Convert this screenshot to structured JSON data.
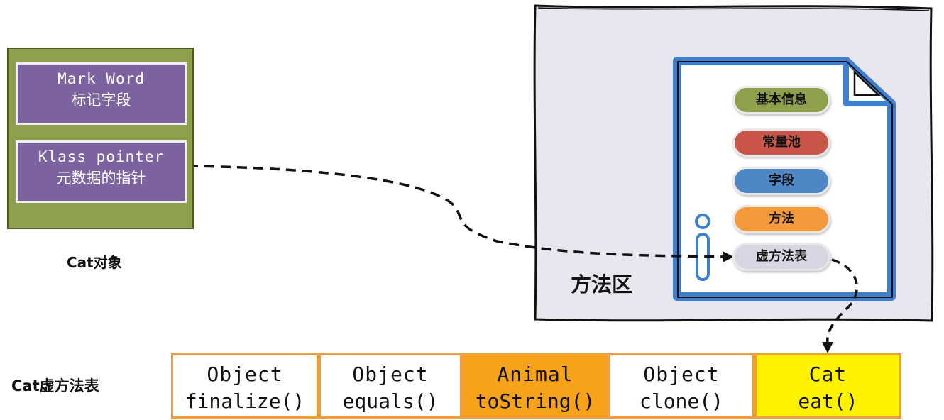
{
  "cat_object": {
    "mark_word": {
      "line1": "Mark Word",
      "line2": "标记字段"
    },
    "klass_pointer": {
      "line1": "Klass pointer",
      "line2": "元数据的指针"
    },
    "label": "Cat对象"
  },
  "method_area": {
    "label": "方法区",
    "items": [
      {
        "label": "基本信息",
        "color": "#8ea04c"
      },
      {
        "label": "常量池",
        "color": "#c95548"
      },
      {
        "label": "字段",
        "color": "#4f86c6"
      },
      {
        "label": "方法",
        "color": "#f49a3c"
      },
      {
        "label": "虚方法表",
        "color": "#d9d6e3"
      }
    ]
  },
  "vtable": {
    "label": "Cat虚方法表",
    "cells": [
      {
        "line1": "Object",
        "line2": "finalize()",
        "bg": "#ffffff"
      },
      {
        "line1": "Object",
        "line2": "equals()",
        "bg": "#ffffff"
      },
      {
        "line1": "Animal",
        "line2": "toString()",
        "bg": "#f7a21b"
      },
      {
        "line1": "Object",
        "line2": "clone()",
        "bg": "#ffffff"
      },
      {
        "line1": "Cat",
        "line2": "eat()",
        "bg": "#fff200"
      }
    ]
  },
  "colors": {
    "object_bg": "#8ea04c",
    "field_bg": "#7d62a0",
    "method_area_bg": "#e8e6ee",
    "document_stroke": "#3f7fd0",
    "cell_border": "#f39c3c"
  }
}
